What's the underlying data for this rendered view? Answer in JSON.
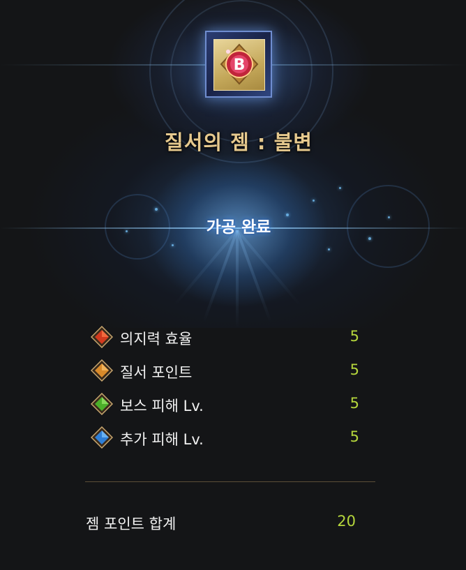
{
  "gem": {
    "title": "질서의 젬 : 불변",
    "icon": "order-gem-rune-b-icon",
    "rune_letter": "B"
  },
  "status": "가공 완료",
  "stats": [
    {
      "label": "의지력 효율",
      "value": "5",
      "icon": "red-diamond-gem-icon",
      "color": "#d23a1e"
    },
    {
      "label": "질서 포인트",
      "value": "5",
      "icon": "orange-diamond-gem-icon",
      "color": "#d98a2a"
    },
    {
      "label": "보스 피해 Lv.",
      "value": "5",
      "icon": "green-diamond-gem-icon",
      "color": "#4caf2a"
    },
    {
      "label": "추가 피해 Lv.",
      "value": "5",
      "icon": "blue-diamond-gem-icon",
      "color": "#2f7fd6"
    }
  ],
  "total": {
    "label": "젬 포인트 합계",
    "value": "20"
  },
  "colors": {
    "title": "#e6c98e",
    "value": "#b5d63c",
    "divider": "#5c4f38",
    "background": "#141517"
  }
}
